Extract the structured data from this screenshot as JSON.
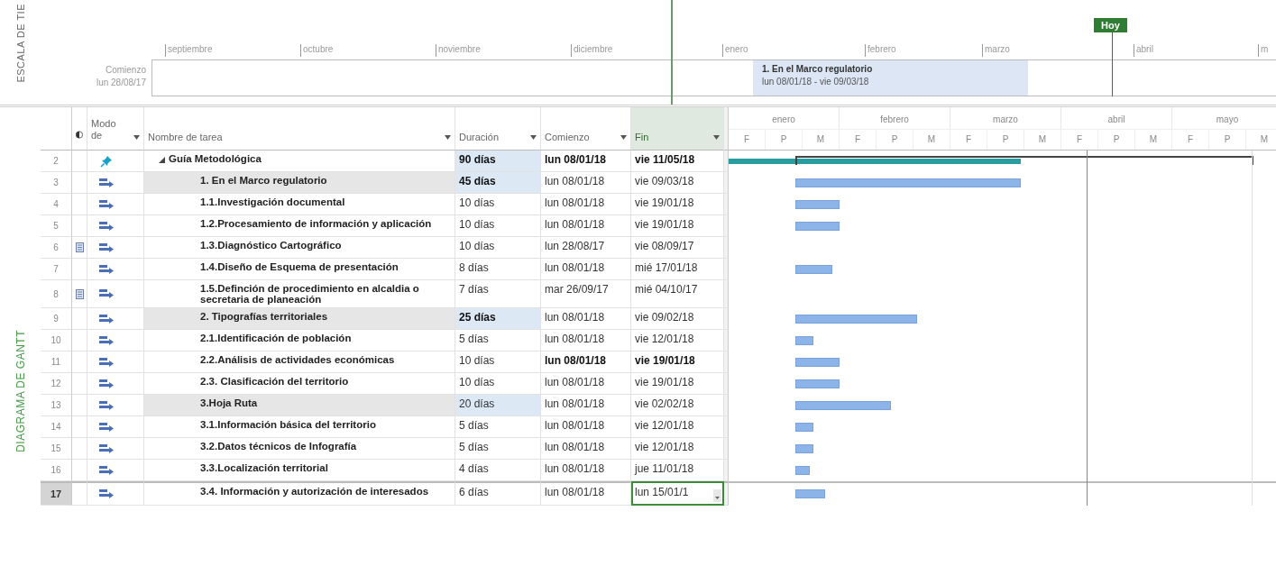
{
  "timeline": {
    "side_label": "ESCALA DE TIE",
    "start_label": "Comienzo",
    "start_date": "lun 28/08/17",
    "months": [
      "septiembre",
      "octubre",
      "noviembre",
      "diciembre",
      "enero",
      "febrero",
      "marzo",
      "abril",
      "m"
    ],
    "today_label": "Hoy",
    "task": {
      "name": "1. En el Marco regulatorio",
      "dates": "lun 08/01/18 - vie 09/03/18"
    }
  },
  "side_label": "DIAGRAMA DE GANTT",
  "columns": [
    {
      "label": "Modo de",
      "selected": false
    },
    {
      "label": "Nombre de tarea",
      "selected": false
    },
    {
      "label": "Duración",
      "selected": false
    },
    {
      "label": "Comienzo",
      "selected": false
    },
    {
      "label": "Fin",
      "selected": true
    }
  ],
  "gantt_header": {
    "months": [
      "enero",
      "febrero",
      "marzo",
      "abril",
      "mayo"
    ],
    "periods": [
      "F",
      "P",
      "M",
      "F",
      "P",
      "M",
      "F",
      "P",
      "M",
      "F",
      "P",
      "M",
      "F",
      "P",
      "M"
    ]
  },
  "tasks": [
    {
      "id": "2",
      "manual": true,
      "note": false,
      "name": "Guía Metodológica",
      "duration": "90 días",
      "start": "lun 08/01/18",
      "finish": "vie 11/05/18",
      "name_shaded": false,
      "duration_shaded": true,
      "bold_duration": true,
      "bold_dates": true,
      "selected": false,
      "expanded": true,
      "children": [
        {
          "id": "3",
          "manual": false,
          "note": false,
          "name": "1. En el Marco regulatorio",
          "duration": "45 días",
          "start": "lun 08/01/18",
          "finish": "vie 09/03/18",
          "name_shaded": true,
          "duration_shaded": true,
          "bold_duration": true,
          "bold_dates": false,
          "selected": false
        },
        {
          "id": "4",
          "manual": false,
          "note": false,
          "name": "1.1.Investigación documental",
          "duration": "10 días",
          "start": "lun 08/01/18",
          "finish": "vie 19/01/18",
          "name_shaded": false,
          "duration_shaded": false,
          "bold_duration": false,
          "bold_dates": false,
          "selected": false
        },
        {
          "id": "5",
          "manual": false,
          "note": false,
          "name": "1.2.Procesamiento de información y aplicación",
          "duration": "10 días",
          "start": "lun 08/01/18",
          "finish": "vie 19/01/18",
          "name_shaded": false,
          "duration_shaded": false,
          "bold_duration": false,
          "bold_dates": false,
          "selected": false
        },
        {
          "id": "6",
          "manual": false,
          "note": true,
          "name": "1.3.Diagnóstico Cartográfico",
          "duration": "10 días",
          "start": "lun 28/08/17",
          "finish": "vie 08/09/17",
          "name_shaded": false,
          "duration_shaded": false,
          "bold_duration": false,
          "bold_dates": false,
          "selected": false
        },
        {
          "id": "7",
          "manual": false,
          "note": false,
          "name": "1.4.Diseño de Esquema de presentación",
          "duration": "8 días",
          "start": "lun 08/01/18",
          "finish": "mié 17/01/18",
          "name_shaded": false,
          "duration_shaded": false,
          "bold_duration": false,
          "bold_dates": false,
          "selected": false
        },
        {
          "id": "8",
          "manual": false,
          "note": true,
          "name": "1.5.Definción de procedimiento en alcaldia o secretaria de planeación",
          "duration": "7 días",
          "start": "mar 26/09/17",
          "finish": "mié 04/10/17",
          "name_shaded": false,
          "duration_shaded": false,
          "bold_duration": false,
          "bold_dates": false,
          "selected": false
        },
        {
          "id": "9",
          "manual": false,
          "note": false,
          "name": "2. Tipografías territoriales",
          "duration": "25 días",
          "start": "lun 08/01/18",
          "finish": "vie 09/02/18",
          "name_shaded": true,
          "duration_shaded": true,
          "bold_duration": true,
          "bold_dates": false,
          "selected": false
        },
        {
          "id": "10",
          "manual": false,
          "note": false,
          "name": "2.1.Identificación de población",
          "duration": "5 días",
          "start": "lun 08/01/18",
          "finish": "vie 12/01/18",
          "name_shaded": false,
          "duration_shaded": false,
          "bold_duration": false,
          "bold_dates": false,
          "selected": false
        },
        {
          "id": "11",
          "manual": false,
          "note": false,
          "name": "2.2.Análisis de actividades económicas",
          "duration": "10 días",
          "start": "lun 08/01/18",
          "finish": "vie 19/01/18",
          "name_shaded": false,
          "duration_shaded": false,
          "bold_duration": false,
          "bold_dates": true,
          "selected": false
        },
        {
          "id": "12",
          "manual": false,
          "note": false,
          "name": "2.3. Clasificación del territorio",
          "duration": "10 días",
          "start": "lun 08/01/18",
          "finish": "vie 19/01/18",
          "name_shaded": false,
          "duration_shaded": false,
          "bold_duration": false,
          "bold_dates": false,
          "selected": false
        },
        {
          "id": "13",
          "manual": false,
          "note": false,
          "name": "3.Hoja Ruta",
          "duration": "20 días",
          "start": "lun 08/01/18",
          "finish": "vie 02/02/18",
          "name_shaded": true,
          "duration_shaded": true,
          "bold_duration": false,
          "bold_dates": false,
          "selected": false
        },
        {
          "id": "14",
          "manual": false,
          "note": false,
          "name": "3.1.Información básica del territorio",
          "duration": "5 días",
          "start": "lun 08/01/18",
          "finish": "vie 12/01/18",
          "name_shaded": false,
          "duration_shaded": false,
          "bold_duration": false,
          "bold_dates": false,
          "selected": false
        },
        {
          "id": "15",
          "manual": false,
          "note": false,
          "name": "3.2.Datos técnicos de Infografía",
          "duration": "5 días",
          "start": "lun 08/01/18",
          "finish": "vie 12/01/18",
          "name_shaded": false,
          "duration_shaded": false,
          "bold_duration": false,
          "bold_dates": false,
          "selected": false
        },
        {
          "id": "16",
          "manual": false,
          "note": false,
          "name": "3.3.Localización territorial",
          "duration": "4 días",
          "start": "lun 08/01/18",
          "finish": "jue 11/01/18",
          "name_shaded": false,
          "duration_shaded": false,
          "bold_duration": false,
          "bold_dates": false,
          "selected": false
        },
        {
          "id": "17",
          "manual": false,
          "note": false,
          "name": "3.4. Información y autorización de interesados",
          "duration": "6 días",
          "start": "lun 08/01/18",
          "finish": "lun 15/01/1",
          "name_shaded": false,
          "duration_shaded": false,
          "bold_duration": false,
          "bold_dates": false,
          "selected": true
        }
      ]
    }
  ]
}
